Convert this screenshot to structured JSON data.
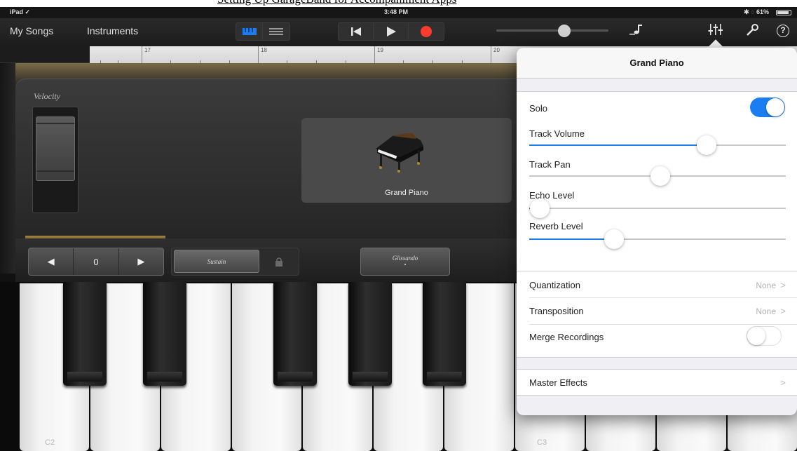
{
  "caption": "Setting Up GarageBand for Accompaniment Apps",
  "status_bar": {
    "carrier": "iPad ✓",
    "time": "3:48 PM",
    "right": "✱ ◌ 61%"
  },
  "toolbar": {
    "my_songs": "My Songs",
    "instruments": "Instruments",
    "accent_color": "#1a7ef2"
  },
  "ruler": {
    "bars": [
      "17",
      "18",
      "19",
      "20"
    ]
  },
  "instrument": {
    "velocity_label": "Velocity",
    "name": "Grand Piano",
    "octave": {
      "down": "◀",
      "value": "0",
      "up": "▶"
    },
    "sustain_label": "Sustain",
    "glissando_label": "Glissando",
    "glissando_dot": "•"
  },
  "keyboard": {
    "labels": [
      "C2",
      "C3"
    ]
  },
  "popover": {
    "title": "Grand Piano",
    "solo_label": "Solo",
    "solo_on": true,
    "sliders": [
      {
        "label": "Track Volume",
        "value": 0.69
      },
      {
        "label": "Track Pan",
        "value": 0.51
      },
      {
        "label": "Echo Level",
        "value": 0.04
      },
      {
        "label": "Reverb Level",
        "value": 0.33
      }
    ],
    "quantization_label": "Quantization",
    "quantization_value": "None",
    "transposition_label": "Transposition",
    "transposition_value": "None",
    "merge_label": "Merge Recordings",
    "merge_on": false,
    "master_effects_label": "Master Effects",
    "chevron": ">"
  }
}
